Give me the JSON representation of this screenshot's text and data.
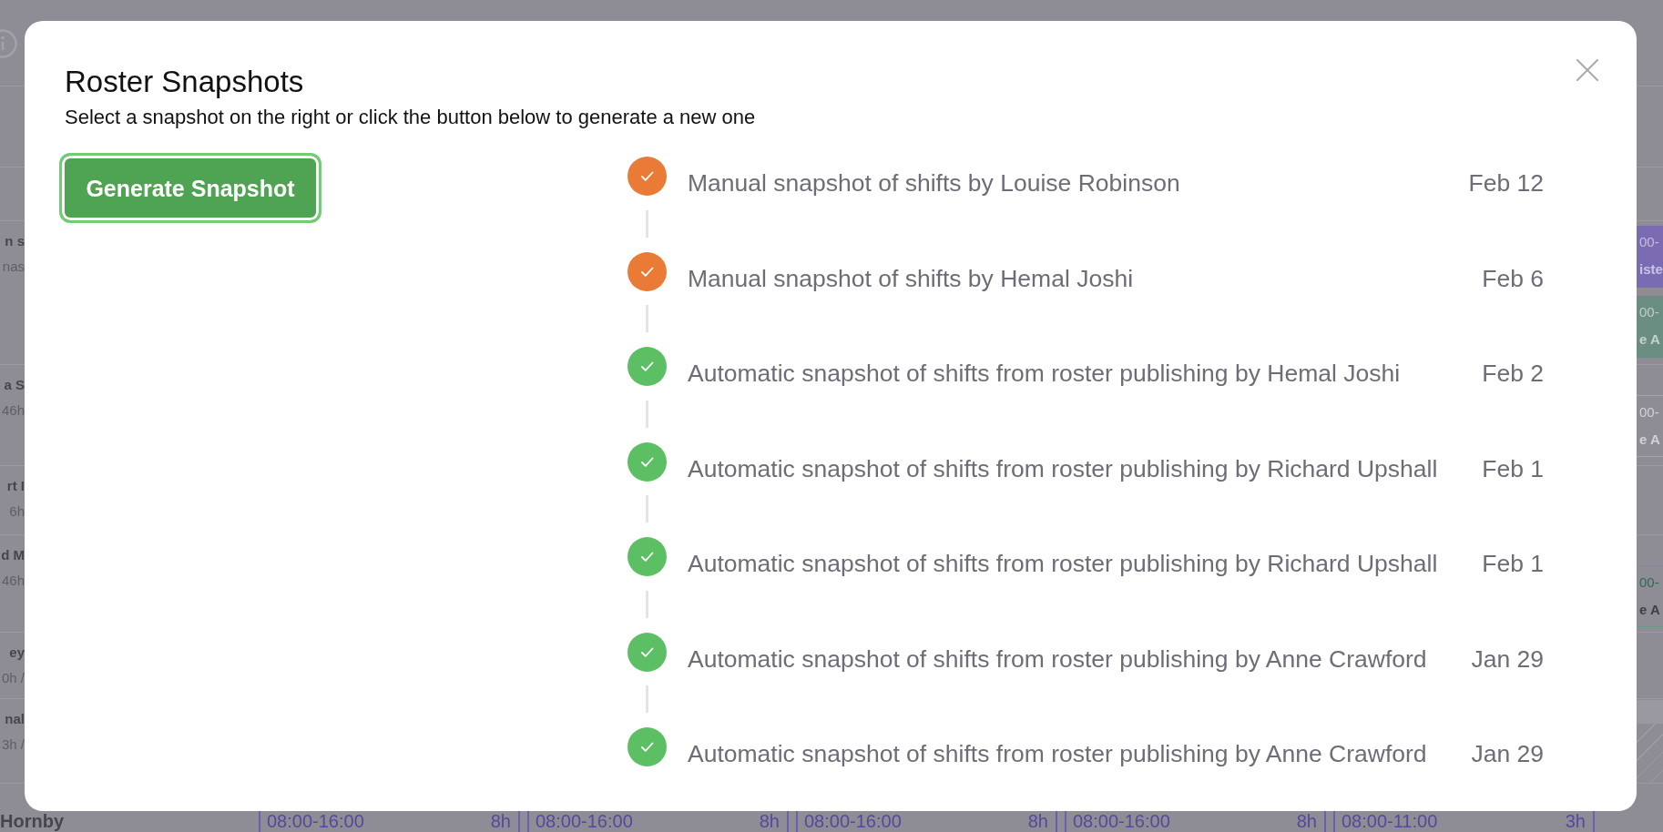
{
  "background": {
    "rows": [
      {
        "line_1": "n s",
        "line_2": "nas",
        "hatched": false,
        "shifts": [
          {
            "kind": "filled",
            "color": "#7b6bb2",
            "line_1": "00-",
            "line_2": "iste"
          },
          {
            "kind": "filled",
            "color": "#6b8e82",
            "line_1": "00-",
            "line_2": "e A"
          }
        ]
      },
      {
        "line_1": "a S",
        "line_2": "46h",
        "hatched": false,
        "shifts": [
          {
            "kind": "faded",
            "color": "#a6a5ad",
            "line_1": "00-",
            "line_2": "e A"
          }
        ]
      },
      {
        "line_1": "rt I",
        "line_2": "6h",
        "hatched": false
      },
      {
        "line_1": "d M",
        "line_2": "46h",
        "hatched": false,
        "shifts": [
          {
            "kind": "outline",
            "color": "#6e9986",
            "line_1": "00-",
            "line_2": "e A"
          }
        ]
      },
      {
        "line_1": "ey",
        "line_2": "0h /",
        "hatched": false
      },
      {
        "line_1": "nal",
        "line_2": "3h /",
        "hatched": true
      }
    ],
    "footer_row": {
      "name": "Hornby",
      "shifts": [
        {
          "time": "08:00-16:00",
          "hours": "8h"
        },
        {
          "time": "08:00-16:00",
          "hours": "8h"
        },
        {
          "time": "08:00-16:00",
          "hours": "8h"
        },
        {
          "time": "08:00-16:00",
          "hours": "8h"
        },
        {
          "time": "08:00-11:00",
          "hours": "3h"
        }
      ]
    }
  },
  "dialog": {
    "title": "Roster Snapshots",
    "subtitle": "Select a snapshot on the right or click the button below to generate a new one",
    "button": "Generate Snapshot",
    "snapshots": [
      {
        "label": "Manual snapshot of shifts by Louise Robinson",
        "date": "Feb 12",
        "color": "#e97b36"
      },
      {
        "label": "Manual snapshot of shifts by Hemal Joshi",
        "date": "Feb 6",
        "color": "#e97b36"
      },
      {
        "label": "Automatic snapshot of shifts from roster publishing by Hemal Joshi",
        "date": "Feb 2",
        "color": "#5dbf64"
      },
      {
        "label": "Automatic snapshot of shifts from roster publishing by Richard Upshall",
        "date": "Feb 1",
        "color": "#5dbf64"
      },
      {
        "label": "Automatic snapshot of shifts from roster publishing by Richard Upshall",
        "date": "Feb 1",
        "color": "#5dbf64"
      },
      {
        "label": "Automatic snapshot of shifts from roster publishing by Anne Crawford",
        "date": "Jan 29",
        "color": "#5dbf64"
      },
      {
        "label": "Automatic snapshot of shifts from roster publishing by Anne Crawford",
        "date": "Jan 29",
        "color": "#5dbf64"
      }
    ]
  }
}
